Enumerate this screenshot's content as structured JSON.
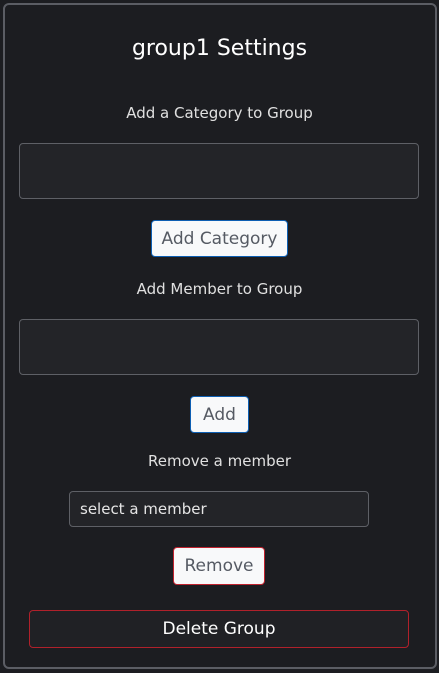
{
  "title": "group1 Settings",
  "category": {
    "label": "Add a Category to Group",
    "value": "",
    "button": "Add Category"
  },
  "member": {
    "label": "Add Member to Group",
    "value": "",
    "button": "Add"
  },
  "remove": {
    "label": "Remove a member",
    "select_value": "select a member",
    "button": "Remove"
  },
  "delete_button": "Delete Group",
  "colors": {
    "primary_border": "#0d5fb3",
    "danger_border": "#c0222e",
    "background": "#1c1d21"
  }
}
